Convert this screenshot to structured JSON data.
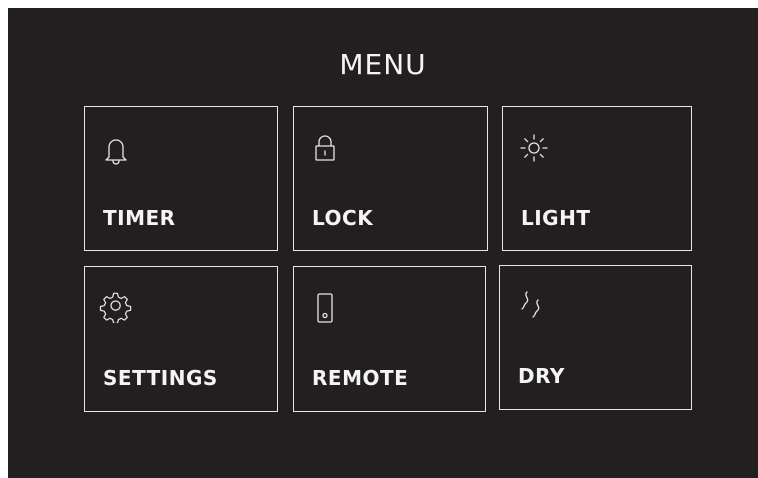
{
  "menu": {
    "title": "MENU",
    "tiles": [
      {
        "label": "TIMER",
        "icon": "bell-icon"
      },
      {
        "label": "LOCK",
        "icon": "lock-icon"
      },
      {
        "label": "LIGHT",
        "icon": "sun-icon"
      },
      {
        "label": "SETTINGS",
        "icon": "gear-icon"
      },
      {
        "label": "REMOTE",
        "icon": "phone-icon"
      },
      {
        "label": "DRY",
        "icon": "wavy-lines-icon"
      }
    ]
  },
  "colors": {
    "background": "#231f20",
    "foreground": "#f4f4f4",
    "border": "#e6e6e6"
  }
}
